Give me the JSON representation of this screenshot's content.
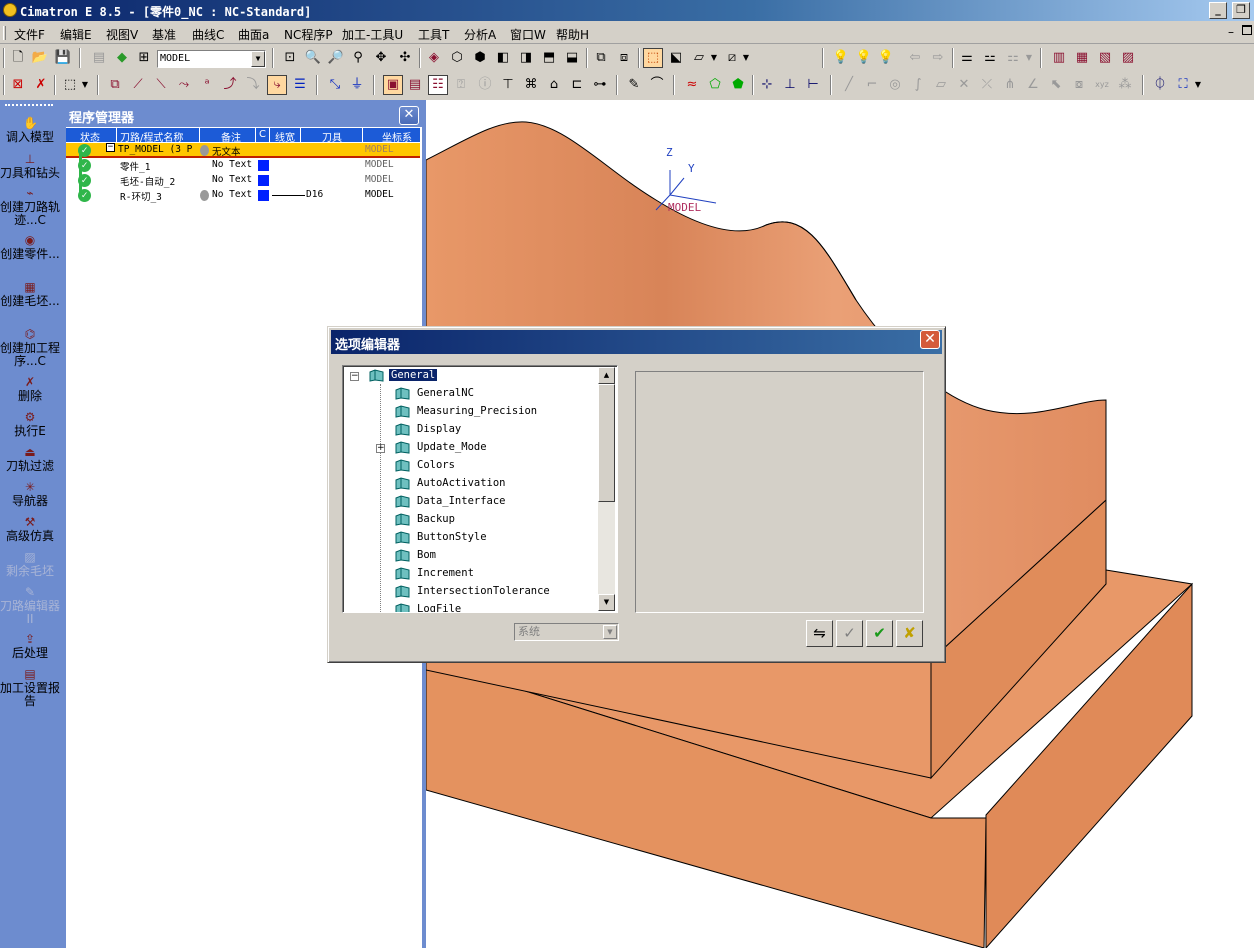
{
  "window": {
    "title": "Cimatron E 8.5 - [零件0_NC : NC-Standard]",
    "min_icon": "minimize-icon",
    "max_icon": "maximize-icon"
  },
  "menu": [
    "文件F",
    "编辑E",
    "视图V",
    "基准",
    "曲线C",
    "曲面a",
    "NC程序P",
    "加工-工具U",
    "工具T",
    "分析A",
    "窗口W",
    "帮助H"
  ],
  "toolbar": {
    "model_combo": "MODEL"
  },
  "left_panel": {
    "items": [
      {
        "label": "调入模型",
        "icon": "load-model-icon",
        "enabled": true
      },
      {
        "label": "刀具和钻头",
        "icon": "tool-drill-icon",
        "enabled": true
      },
      {
        "label": "创建刀路轨迹...C",
        "icon": "create-toolpath-icon",
        "enabled": true
      },
      {
        "label": "创建零件...",
        "icon": "create-part-icon",
        "enabled": true
      },
      {
        "label": "创建毛坯...",
        "icon": "create-stock-icon",
        "enabled": true
      },
      {
        "label": "创建加工程序...C",
        "icon": "create-procedure-icon",
        "enabled": true
      },
      {
        "label": "删除",
        "icon": "delete-icon",
        "enabled": true
      },
      {
        "label": "执行E",
        "icon": "execute-icon",
        "enabled": true
      },
      {
        "label": "刀轨过滤",
        "icon": "filter-icon",
        "enabled": true
      },
      {
        "label": "导航器",
        "icon": "navigator-icon",
        "enabled": true
      },
      {
        "label": "高级仿真",
        "icon": "simulation-icon",
        "enabled": true
      },
      {
        "label": "剩余毛坯",
        "icon": "remaining-stock-icon",
        "enabled": false
      },
      {
        "label": "刀路编辑器II",
        "icon": "toolpath-editor-icon",
        "enabled": false
      },
      {
        "label": "后处理",
        "icon": "post-process-icon",
        "enabled": true
      },
      {
        "label": "加工设置报告",
        "icon": "setup-report-icon",
        "enabled": true
      }
    ]
  },
  "program_manager": {
    "title": "程序管理器",
    "columns": [
      "状态",
      "刀路/程式名称",
      "备注",
      "C",
      "线宽",
      "刀具",
      "坐标系"
    ],
    "rows": [
      {
        "name": "TP_MODEL (3 P",
        "note": "无文本",
        "tool": "",
        "ucs": "MODEL",
        "selected": true
      },
      {
        "name": "零件_1",
        "note": "No Text",
        "tool": "",
        "ucs": "MODEL",
        "selected": false
      },
      {
        "name": "毛坯-自动_2",
        "note": "No Text",
        "tool": "",
        "ucs": "MODEL",
        "selected": false
      },
      {
        "name": "R-环切_3",
        "note": "No Text",
        "tool": "D16",
        "ucs": "MODEL",
        "selected": false
      }
    ]
  },
  "viewport": {
    "axis_z": "Z",
    "axis_y": "Y",
    "ucs_label": "MODEL",
    "part_color": "#e8966a",
    "part_dark": "#d48055",
    "part_light": "#eea880"
  },
  "options_dialog": {
    "title": "选项编辑器",
    "tree_root": "General",
    "tree_items": [
      "GeneralNC",
      "Measuring_Precision",
      "Display",
      "Update_Mode",
      "Colors",
      "AutoActivation",
      "Data_Interface",
      "Backup",
      "ButtonStyle",
      "Bom",
      "Increment",
      "IntersectionTolerance",
      "LogFile"
    ],
    "system_combo": "系统"
  }
}
